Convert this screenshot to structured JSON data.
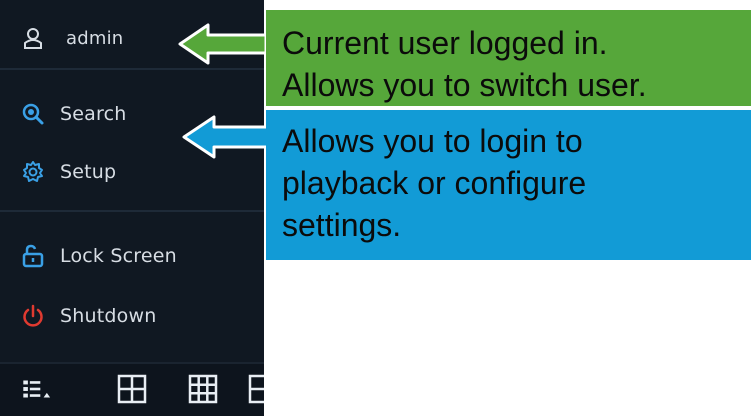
{
  "menu": {
    "user": {
      "name": "admin",
      "icon": "user-icon"
    },
    "items": [
      {
        "label": "Search",
        "icon": "search-icon"
      },
      {
        "label": "Setup",
        "icon": "gear-icon"
      },
      {
        "label": "Lock Screen",
        "icon": "lock-open-icon"
      },
      {
        "label": "Shutdown",
        "icon": "power-icon"
      }
    ],
    "bottom_bar": [
      "layout-menu-icon",
      "grid-4-icon",
      "grid-9-icon",
      "grid-partial-icon"
    ]
  },
  "callouts": {
    "green": {
      "lines": [
        "Current user logged in.",
        "Allows you to switch user."
      ],
      "color": "#56a73a"
    },
    "blue": {
      "lines": [
        "Allows you to login to",
        "playback or configure",
        "settings."
      ],
      "color": "#129bd6"
    }
  },
  "colors": {
    "menu_bg": "#101822",
    "icon_blue": "#3aa0e6",
    "icon_red": "#e03a30"
  }
}
